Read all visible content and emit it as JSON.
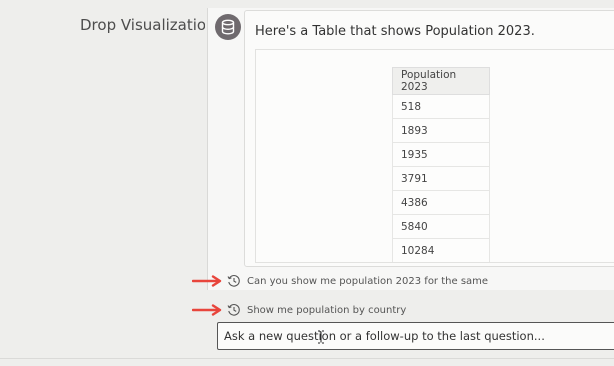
{
  "background": {
    "title": "Drop Visualizations c"
  },
  "assistant": {
    "icon": "database-icon",
    "message": "Here's a Table that shows Population 2023."
  },
  "table": {
    "header": "Population 2023",
    "rows": [
      "518",
      "1893",
      "1935",
      "3791",
      "4386",
      "5840",
      "10284"
    ]
  },
  "suggestions": [
    {
      "icon": "history-icon",
      "text": "Can you show me population 2023 for the same"
    },
    {
      "icon": "history-icon",
      "text": "Show me population by country"
    }
  ],
  "input": {
    "placeholder": "Ask a new question or a follow-up to the last question..."
  },
  "colors": {
    "annotation_arrow": "#e8453c",
    "avatar": "#6f6a6e"
  }
}
